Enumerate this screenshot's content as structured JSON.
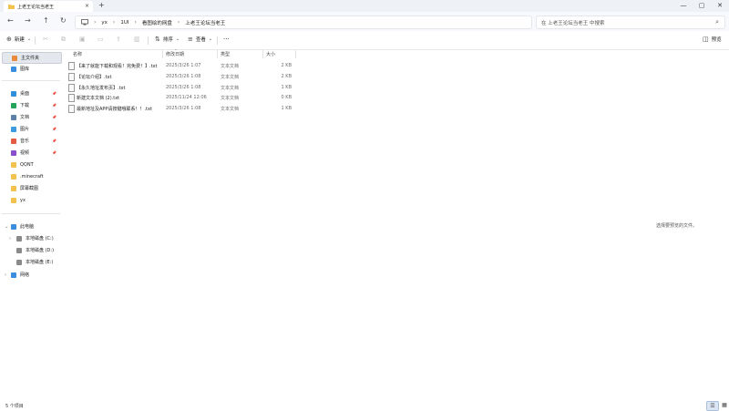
{
  "window": {
    "tab_title": "上老王论坛当老王",
    "tab_close": "×",
    "new_tab": "+",
    "minimize": "—",
    "maximize": "▢",
    "close": "✕"
  },
  "address": {
    "back": "←",
    "forward": "→",
    "up": "↑",
    "refresh": "↻",
    "breadcrumbs": [
      "yx",
      "1UI",
      "看图绘的网盘",
      "上老王论坛当老王"
    ],
    "search_placeholder": "在 上老王论坛当老王 中搜索"
  },
  "toolbar": {
    "new_label": "新建",
    "sort_label": "排序",
    "view_label": "查看",
    "more_label": "···",
    "preview_label": "预览"
  },
  "sidebar": {
    "quick": [
      {
        "label": "主文件夹",
        "color": "#e88a3b",
        "selected": true
      },
      {
        "label": "图库",
        "color": "#3b8de0"
      }
    ],
    "pinned": [
      {
        "label": "桌面",
        "color": "#2f8fdc",
        "pin": "📌"
      },
      {
        "label": "下载",
        "color": "#24a35a",
        "pin": "📌"
      },
      {
        "label": "文档",
        "color": "#5d7fa8",
        "pin": "📌"
      },
      {
        "label": "图片",
        "color": "#3c9ae0",
        "pin": "📌"
      },
      {
        "label": "音乐",
        "color": "#e35b43",
        "pin": "📌"
      },
      {
        "label": "视频",
        "color": "#8a4fcf",
        "pin": "📌"
      },
      {
        "label": "QQNT",
        "color": "#f2c14e"
      },
      {
        "label": ".minecraft",
        "color": "#f2c14e"
      },
      {
        "label": "屏幕截图",
        "color": "#f2c14e"
      },
      {
        "label": "yx",
        "color": "#f2c14e"
      }
    ],
    "tree": [
      {
        "label": "此电脑",
        "color": "#3b8de0",
        "chevron": "⌄"
      },
      {
        "label": "本地磁盘 (C:)",
        "color": "#8a8a8a",
        "chevron": "›"
      },
      {
        "label": "本地磁盘 (D:)",
        "color": "#8a8a8a"
      },
      {
        "label": "本地磁盘 (E:)",
        "color": "#8a8a8a"
      },
      {
        "label": "网络",
        "color": "#3b8de0",
        "chevron": "›"
      }
    ]
  },
  "table": {
    "columns": {
      "name": "名称",
      "date": "修改日期",
      "type": "类型",
      "size": "大小"
    },
    "rows": [
      {
        "name": "【来了就能下载和观看！完免费！】.txt",
        "date": "2025/3/26 1:07",
        "type": "文本文档",
        "size": "2 KB"
      },
      {
        "name": "【论坛介绍】.txt",
        "date": "2025/3/26 1:08",
        "type": "文本文档",
        "size": "2 KB"
      },
      {
        "name": "【永久地址发布页】.txt",
        "date": "2025/3/26 1:08",
        "type": "文本文档",
        "size": "1 KB"
      },
      {
        "name": "新建文本文档 (2).txt",
        "date": "2025/11/24 12:06",
        "type": "文本文档",
        "size": "0 KB"
      },
      {
        "name": "最新地址及APP请按键哦联系！！.txt",
        "date": "2025/3/26 1:08",
        "type": "文本文档",
        "size": "1 KB"
      }
    ]
  },
  "preview": {
    "message": "选择要预览的文件。"
  },
  "status": {
    "item_count": "5 个项目"
  }
}
